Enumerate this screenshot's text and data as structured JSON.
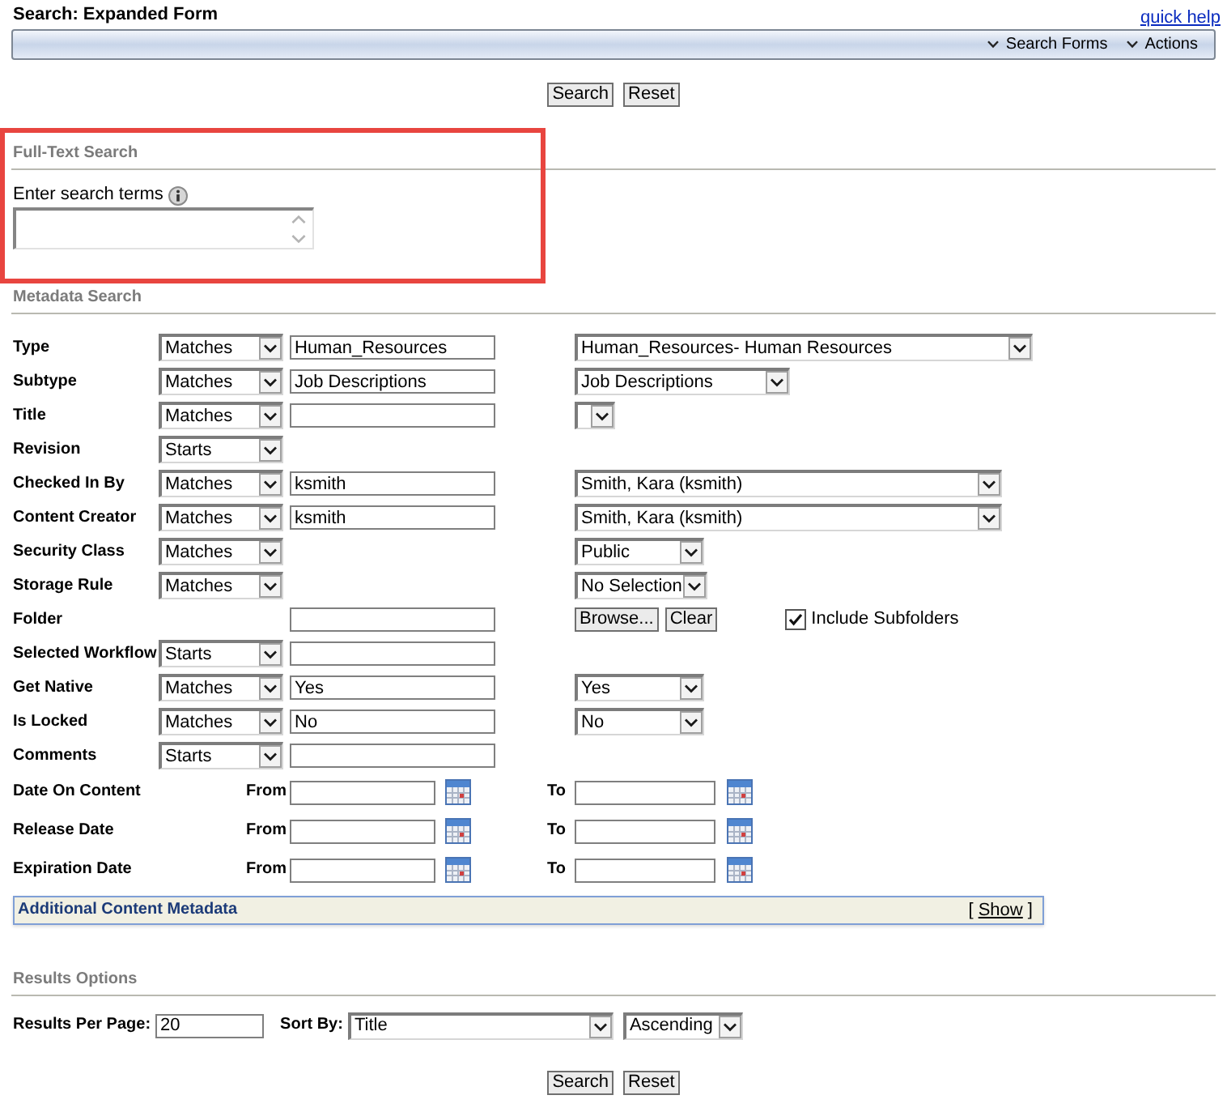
{
  "header": {
    "title": "Search: Expanded Form",
    "help_link": "quick help"
  },
  "toolbar": {
    "menus": [
      "Search Forms",
      "Actions"
    ]
  },
  "top_buttons": [
    "Search",
    "Reset"
  ],
  "full_text_search": {
    "heading": "Full-Text Search",
    "highlighted": true,
    "label": "Enter search terms"
  },
  "metadata_search": {
    "heading": "Metadata Search",
    "fields": [
      {
        "label": "Type",
        "operator": "Matches",
        "text_field": true,
        "value": "Human_Resources",
        "choice": {
          "kind": "select",
          "value": "Human_Resources- Human Resources"
        }
      },
      {
        "label": "Subtype",
        "operator": "Matches",
        "text_field": true,
        "value": "Job Descriptions",
        "choice": {
          "kind": "select",
          "value": "Job Descriptions"
        }
      },
      {
        "label": "Title",
        "operator": "Matches",
        "text_field": true,
        "choice": {
          "kind": "select"
        }
      },
      {
        "label": "Revision",
        "operator": "Starts",
        "text_field": false
      },
      {
        "label": "Checked In By",
        "operator": "Matches",
        "text_field": true,
        "value": "ksmith",
        "choice": {
          "kind": "select",
          "value": "Smith, Kara (ksmith)"
        }
      },
      {
        "label": "Content Creator",
        "operator": "Matches",
        "text_field": true,
        "value": "ksmith",
        "choice": {
          "kind": "select",
          "value": "Smith, Kara (ksmith)"
        }
      },
      {
        "label": "Security Class",
        "operator": "Matches",
        "text_field": false,
        "choice": {
          "kind": "select",
          "value": "Public"
        }
      },
      {
        "label": "Storage Rule",
        "operator": "Matches",
        "text_field": false,
        "choice": {
          "kind": "select",
          "value": "No Selection"
        }
      },
      {
        "label": "Folder",
        "text_field": true,
        "choice": {
          "kind": "folder",
          "buttons": [
            "Browse...",
            "Clear"
          ],
          "checkbox": {
            "label": "Include Subfolders",
            "checked": true
          }
        }
      },
      {
        "label": "Selected Workflow",
        "operator": "Starts",
        "text_field": true
      },
      {
        "label": "Get Native",
        "operator": "Matches",
        "text_field": true,
        "value": "Yes",
        "choice": {
          "kind": "select",
          "value": "Yes"
        }
      },
      {
        "label": "Is Locked",
        "operator": "Matches",
        "text_field": true,
        "value": "No",
        "choice": {
          "kind": "select",
          "value": "No"
        }
      },
      {
        "label": "Comments",
        "operator": "Starts",
        "text_field": true
      }
    ],
    "date_fields": [
      {
        "label": "Date On Content",
        "from_label": "From",
        "to_label": "To"
      },
      {
        "label": "Release Date",
        "from_label": "From",
        "to_label": "To"
      },
      {
        "label": "Expiration Date",
        "from_label": "From",
        "to_label": "To"
      }
    ]
  },
  "additional_metadata": {
    "title": "Additional Content Metadata",
    "toggle_open": "[",
    "toggle_label": "Show",
    "toggle_close": "]"
  },
  "results_options": {
    "heading": "Results Options",
    "per_page_label": "Results Per Page:",
    "per_page": "20",
    "sort_label": "Sort By:",
    "sort_field": "Title",
    "sort_order": "Ascending"
  },
  "bottom_buttons": [
    "Search",
    "Reset"
  ]
}
